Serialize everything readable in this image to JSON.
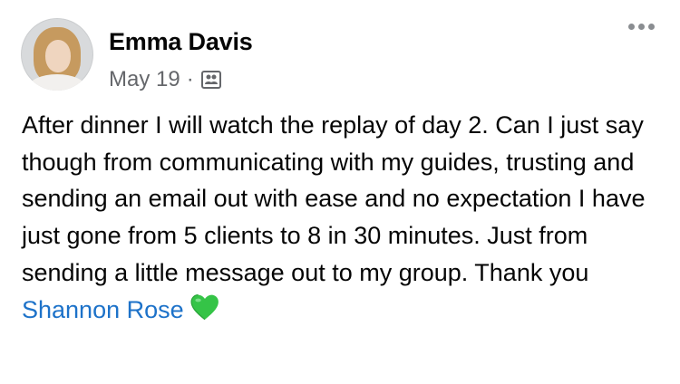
{
  "post": {
    "author": "Emma Davis",
    "date": "May 19",
    "separator": "·",
    "audience_icon": "group-icon",
    "more_icon": "more-horizontal-icon",
    "text": "After dinner I will watch the replay of day 2. Can I just say though from communicating with my guides, trusting and sending an email out with ease and no expectation I have just gone from 5 clients to 8 in 30 minutes. Just from sending a little message out to my group. Thank you ",
    "mention": "Shannon Rose",
    "emoji": "green-heart",
    "mention_color": "#1d72c9",
    "emoji_color": "#35c447"
  }
}
